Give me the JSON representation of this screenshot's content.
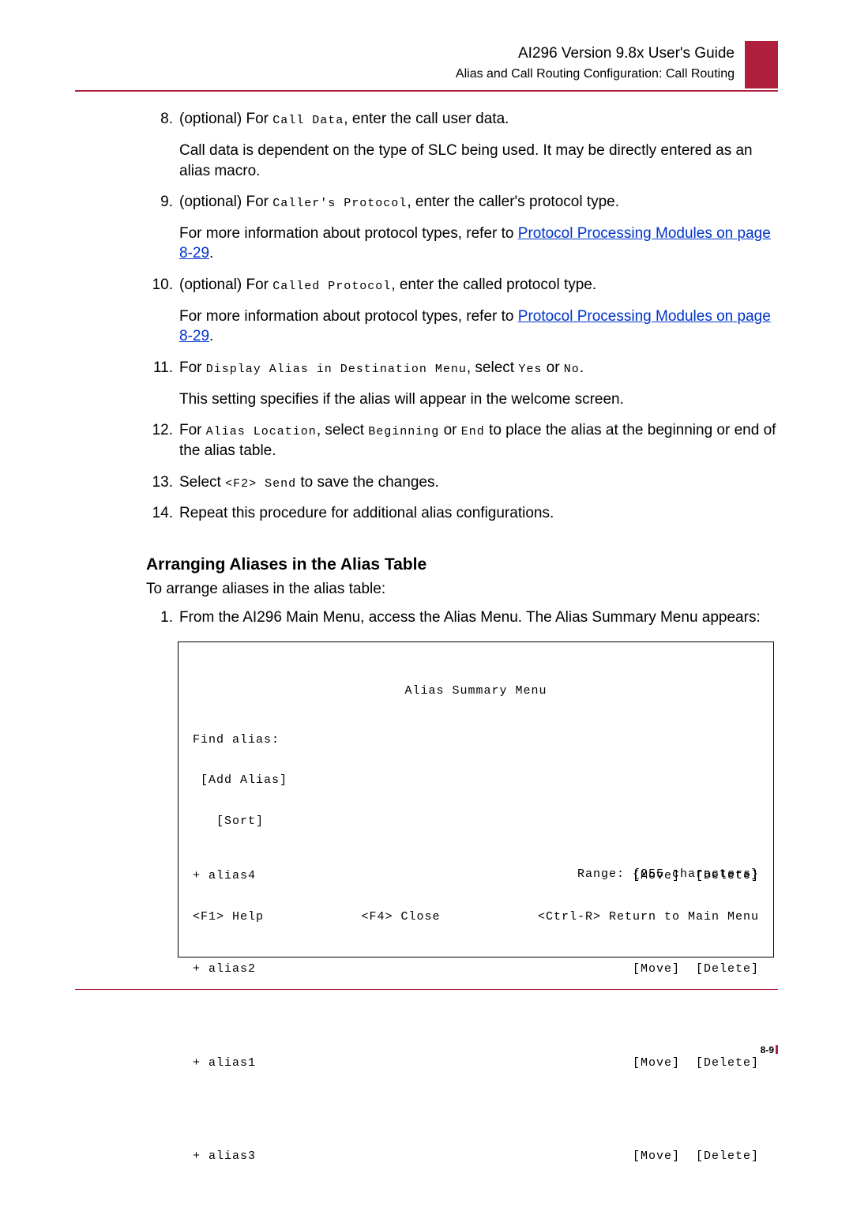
{
  "header": {
    "title": "AI296 Version 9.8x User's Guide",
    "subtitle": "Alias and Call Routing Configuration: Call Routing"
  },
  "steps": [
    {
      "num": "8.",
      "parts": [
        {
          "pre": "(optional) For ",
          "code": "Call Data",
          "post": ", enter the call user data."
        }
      ],
      "extra": "Call data is dependent on the type of SLC being used. It may be directly entered as an alias macro."
    },
    {
      "num": "9.",
      "parts": [
        {
          "pre": "(optional) For ",
          "code": "Caller's Protocol",
          "post": ", enter the caller's protocol type."
        }
      ],
      "extra_pre": "For more information about protocol types, refer to ",
      "link": "Protocol Processing Modules on page 8-29",
      "extra_post": "."
    },
    {
      "num": "10.",
      "parts": [
        {
          "pre": "(optional) For ",
          "code": "Called Protocol",
          "post": ", enter the called protocol type."
        }
      ],
      "extra_pre": "For more information about protocol types, refer to ",
      "link": "Protocol Processing Modules on page 8-29",
      "extra_post": "."
    },
    {
      "num": "11.",
      "line11_pre": "For ",
      "line11_code1": "Display Alias in Destination Menu",
      "line11_mid": ", select ",
      "line11_code2": "Yes",
      "line11_or": " or ",
      "line11_code3": "No",
      "line11_post": ".",
      "extra": "This setting specifies if the alias will appear in the welcome screen."
    },
    {
      "num": "12.",
      "line12_pre": "For ",
      "line12_code1": "Alias Location",
      "line12_mid": ", select ",
      "line12_code2": "Beginning",
      "line12_or": " or ",
      "line12_code3": "End",
      "line12_post": " to place the alias at the beginning or end of the alias table."
    },
    {
      "num": "13.",
      "line13_pre": "Select ",
      "line13_code": "<F2> Send",
      "line13_post": " to save the changes."
    },
    {
      "num": "14.",
      "text": "Repeat this procedure for additional alias configurations."
    }
  ],
  "section": {
    "heading": "Arranging Aliases in the Alias Table",
    "intro": "To arrange aliases in the alias table:",
    "step1_num": "1.",
    "step1_text": "From the AI296 Main Menu, access the Alias Menu. The Alias Summary Menu appears:"
  },
  "terminal": {
    "title": "Alias Summary Menu",
    "find": "Find alias:",
    "add": " [Add Alias]",
    "sort": "   [Sort]",
    "rows": [
      {
        "name": "+ alias4",
        "actions": "[Move]  [Delete]"
      },
      {
        "name": "+ alias2",
        "actions": "[Move]  [Delete]"
      },
      {
        "name": "+ alias1",
        "actions": "[Move]  [Delete]"
      },
      {
        "name": "+ alias3",
        "actions": "[Move]  [Delete]"
      }
    ],
    "range": "Range: {255 characters}",
    "help": "<F1> Help",
    "close": "<F4> Close",
    "return": "<Ctrl-R> Return to Main Menu"
  },
  "page_number": "8-9"
}
